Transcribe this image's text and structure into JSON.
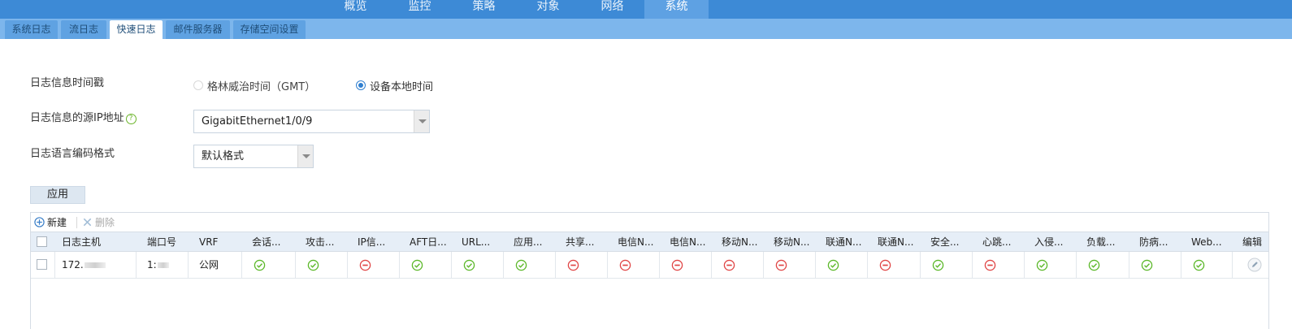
{
  "topnav": {
    "tabs": [
      {
        "label": "概览",
        "active": false
      },
      {
        "label": "监控",
        "active": false
      },
      {
        "label": "策略",
        "active": false
      },
      {
        "label": "对象",
        "active": false
      },
      {
        "label": "网络",
        "active": false
      },
      {
        "label": "系统",
        "active": true
      }
    ]
  },
  "subnav": {
    "tabs": [
      {
        "label": "系统日志",
        "active": false
      },
      {
        "label": "流日志",
        "active": false
      },
      {
        "label": "快速日志",
        "active": true
      },
      {
        "label": "邮件服务器",
        "active": false
      },
      {
        "label": "存储空间设置",
        "active": false
      }
    ]
  },
  "form": {
    "timestamp_label": "日志信息时间戳",
    "timestamp_options": [
      {
        "label": "格林威治时间（GMT）",
        "checked": false
      },
      {
        "label": "设备本地时间",
        "checked": true
      }
    ],
    "source_ip_label": "日志信息的源IP地址",
    "source_ip_value": "GigabitEthernet1/0/9",
    "encoding_label": "日志语言编码格式",
    "encoding_value": "默认格式",
    "apply_label": "应用"
  },
  "toolbar": {
    "new_label": "新建",
    "delete_label": "删除"
  },
  "table": {
    "columns": [
      "日志主机",
      "端口号",
      "VRF",
      "会话...",
      "攻击...",
      "IP信...",
      "AFT日...",
      "URL...",
      "应用...",
      "共享...",
      "电信N...",
      "电信N...",
      "移动N...",
      "移动N...",
      "联通N...",
      "联通N...",
      "安全...",
      "心跳...",
      "入侵...",
      "负载...",
      "防病...",
      "Web...",
      "编辑"
    ],
    "rows": [
      {
        "host": "172.",
        "port": "1:",
        "vrf": "公网",
        "statuses": [
          "ok",
          "ok",
          "off",
          "ok",
          "ok",
          "ok",
          "off",
          "off",
          "off",
          "off",
          "off",
          "ok",
          "off",
          "ok",
          "off",
          "ok",
          "ok",
          "ok",
          "ok"
        ]
      }
    ]
  },
  "colors": {
    "nav_bg": "#3d8ad6",
    "subnav_bg": "#7db6ec",
    "ok": "#5cb82a",
    "off": "#e04646"
  }
}
